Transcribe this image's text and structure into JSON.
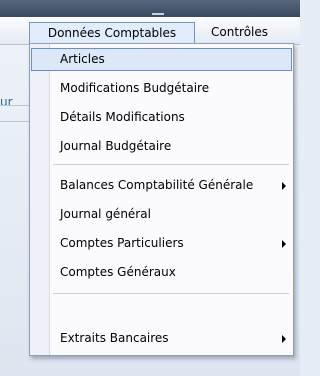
{
  "menubar": {
    "active_menu": "Données Comptables",
    "other_menu": "Contrôles"
  },
  "background": {
    "partial_text": "ur"
  },
  "dropdown": {
    "group1": [
      {
        "label": "Articles",
        "highlighted": true,
        "submenu": false
      },
      {
        "label": "Modifications Budgétaire",
        "highlighted": false,
        "submenu": false
      },
      {
        "label": "Détails Modifications",
        "highlighted": false,
        "submenu": false
      },
      {
        "label": "Journal Budgétaire",
        "highlighted": false,
        "submenu": false
      }
    ],
    "group2": [
      {
        "label": "Balances Comptabilité Générale",
        "submenu": true
      },
      {
        "label": "Journal général",
        "submenu": false
      },
      {
        "label": "Comptes Particuliers",
        "submenu": true
      },
      {
        "label": "Comptes Généraux",
        "submenu": false
      }
    ],
    "group3": [
      {
        "label": "Extraits Bancaires",
        "submenu": true
      }
    ]
  },
  "icons": {
    "submenu_arrow": "chevron-right-icon"
  },
  "colors": {
    "highlight_bg": "#dbe8f8",
    "highlight_border": "#6c8ec4",
    "menu_active_border": "#7594c2"
  }
}
